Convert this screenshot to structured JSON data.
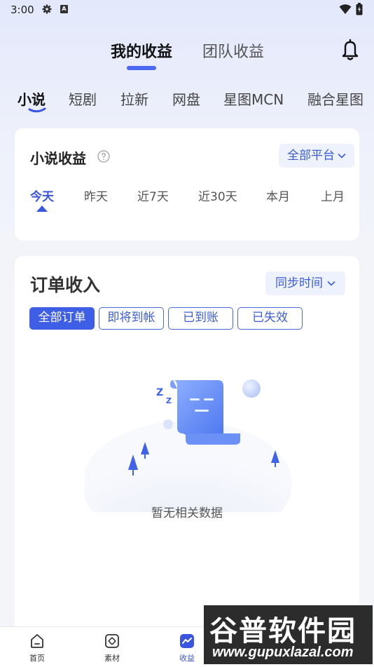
{
  "status_bar": {
    "time": "3:00",
    "badge": "A"
  },
  "header": {
    "tabs": [
      {
        "label": "我的收益",
        "active": true
      },
      {
        "label": "团队收益",
        "active": false
      }
    ]
  },
  "categories": [
    "小说",
    "短剧",
    "拉新",
    "网盘",
    "星图MCN",
    "融合星图"
  ],
  "income_card": {
    "title": "小说收益",
    "platform_filter": "全部平台",
    "periods": [
      "今天",
      "昨天",
      "近7天",
      "近30天",
      "本月",
      "上月"
    ]
  },
  "orders_card": {
    "title": "订单收入",
    "sort": "同步时间",
    "chips": [
      "全部订单",
      "即将到帐",
      "已到账",
      "已失效"
    ],
    "empty_text": "暂无相关数据"
  },
  "bottom_nav": [
    {
      "label": "首页",
      "icon": "home-icon"
    },
    {
      "label": "素材",
      "icon": "material-icon"
    },
    {
      "label": "收益",
      "icon": "income-chart-icon"
    }
  ],
  "watermark": {
    "cn": "谷普软件园",
    "en": "www.gupuxlazal.com"
  },
  "colors": {
    "accent": "#3e5ee6",
    "accent_light": "#eef2fd"
  }
}
